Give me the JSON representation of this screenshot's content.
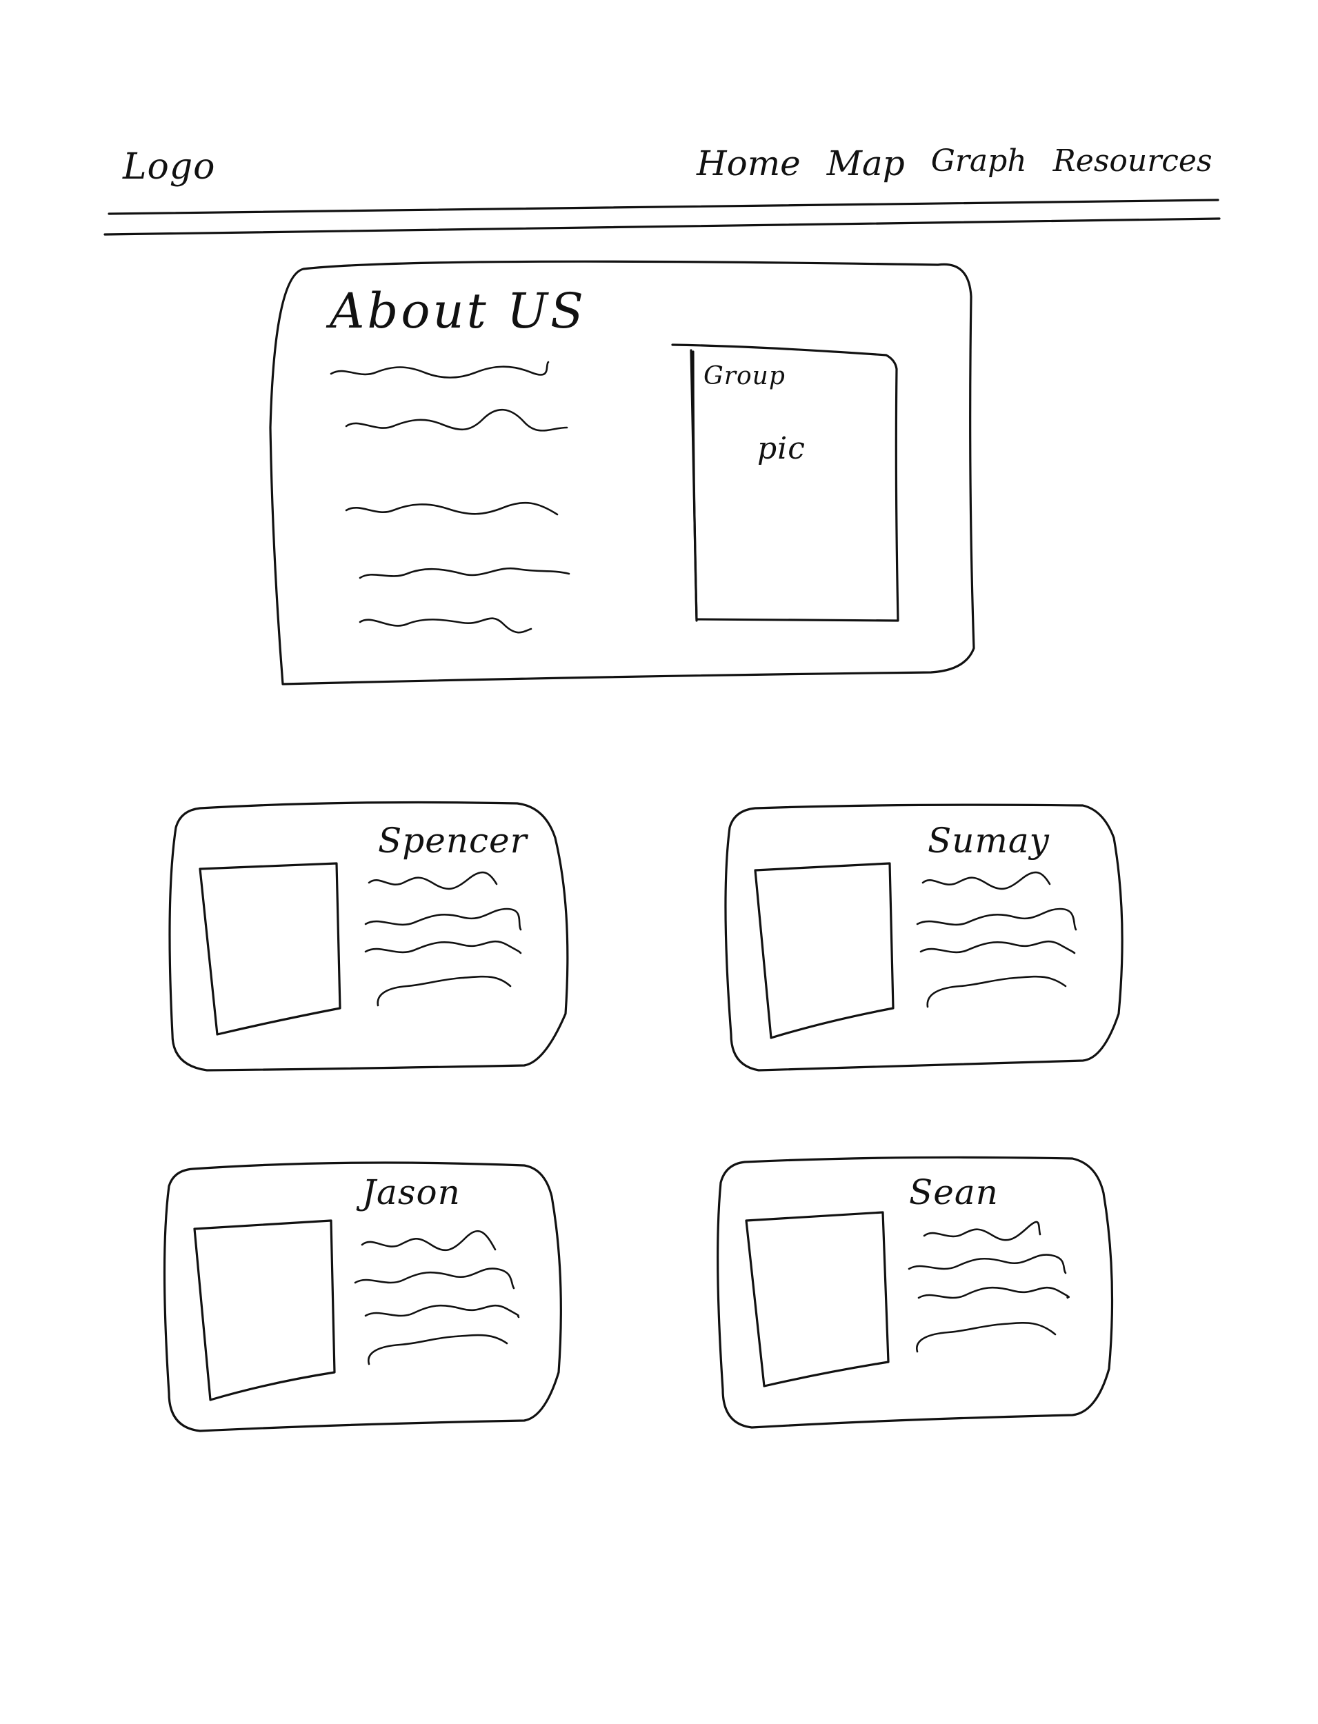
{
  "header": {
    "logo": "Logo",
    "nav": [
      {
        "label": "Home"
      },
      {
        "label": "Map"
      },
      {
        "label": "Graph"
      },
      {
        "label": "Resources"
      }
    ]
  },
  "about": {
    "title": "About US",
    "group_pic": {
      "line1": "Group",
      "line2": "pic"
    }
  },
  "members": [
    {
      "name": "Spencer"
    },
    {
      "name": "Sumay"
    },
    {
      "name": "Jason"
    },
    {
      "name": "Sean"
    }
  ]
}
